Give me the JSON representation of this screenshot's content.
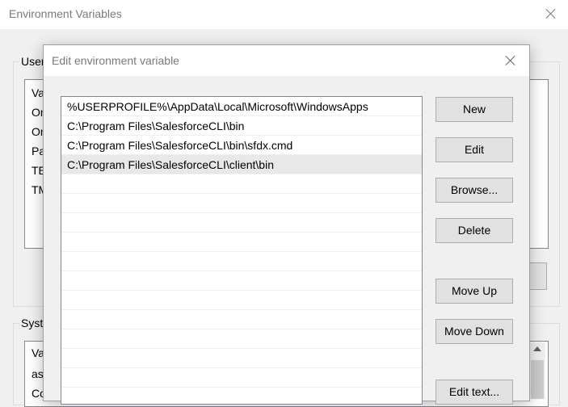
{
  "background_window": {
    "title": "Environment Variables",
    "user_group_label": "User",
    "user_rows": [
      "Va",
      "On",
      "On",
      "Pa",
      "TE",
      "TM"
    ],
    "system_group_label": "Syste",
    "system_rows": [
      "Va",
      "as",
      "Co"
    ]
  },
  "dialog": {
    "title": "Edit environment variable",
    "paths": [
      "%USERPROFILE%\\AppData\\Local\\Microsoft\\WindowsApps",
      "C:\\Program Files\\SalesforceCLI\\bin",
      "C:\\Program Files\\SalesforceCLI\\bin\\sfdx.cmd",
      "C:\\Program Files\\SalesforceCLI\\client\\bin",
      "",
      "",
      "",
      "",
      "",
      "",
      "",
      "",
      "",
      "",
      "",
      ""
    ],
    "selected_index": 3,
    "buttons": {
      "new": "New",
      "edit": "Edit",
      "browse": "Browse...",
      "delete": "Delete",
      "move_up": "Move Up",
      "move_down": "Move Down",
      "edit_text": "Edit text..."
    }
  }
}
